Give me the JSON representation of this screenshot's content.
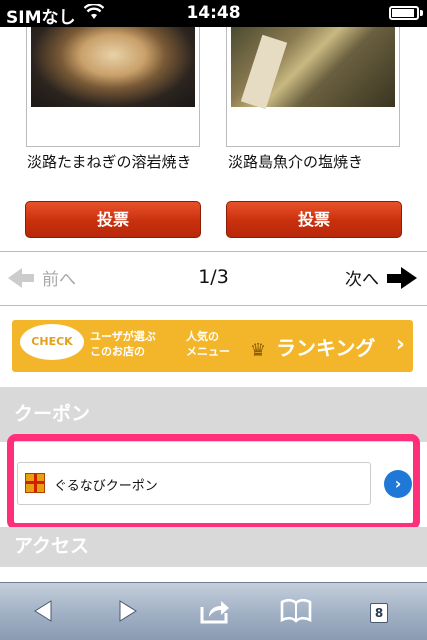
{
  "status_bar": {
    "carrier": "SIMなし",
    "time": "14:48"
  },
  "menu_items": [
    {
      "title": "淡路たまねぎの溶岩焼き",
      "vote_label": "投票"
    },
    {
      "title": "淡路島魚介の塩焼き",
      "vote_label": "投票"
    }
  ],
  "pager": {
    "prev_label": "前へ",
    "page": "1/3",
    "next_label": "次へ"
  },
  "ranking_banner": {
    "badge": "CHECK",
    "lead": [
      "ユーザが選ぶ",
      "このお店の"
    ],
    "popular": [
      "人気の",
      "メニュー"
    ],
    "label": "ランキング"
  },
  "coupon": {
    "heading": "クーポン",
    "item_label": "ぐるなびクーポン"
  },
  "access": {
    "heading": "アクセス"
  },
  "toolbar": {
    "tabs_count": "8"
  },
  "colors": {
    "vote_button": "#d2380f",
    "banner": "#f3b52a",
    "highlight": "#ff2f7a",
    "coupon_button": "#1f78d8"
  }
}
